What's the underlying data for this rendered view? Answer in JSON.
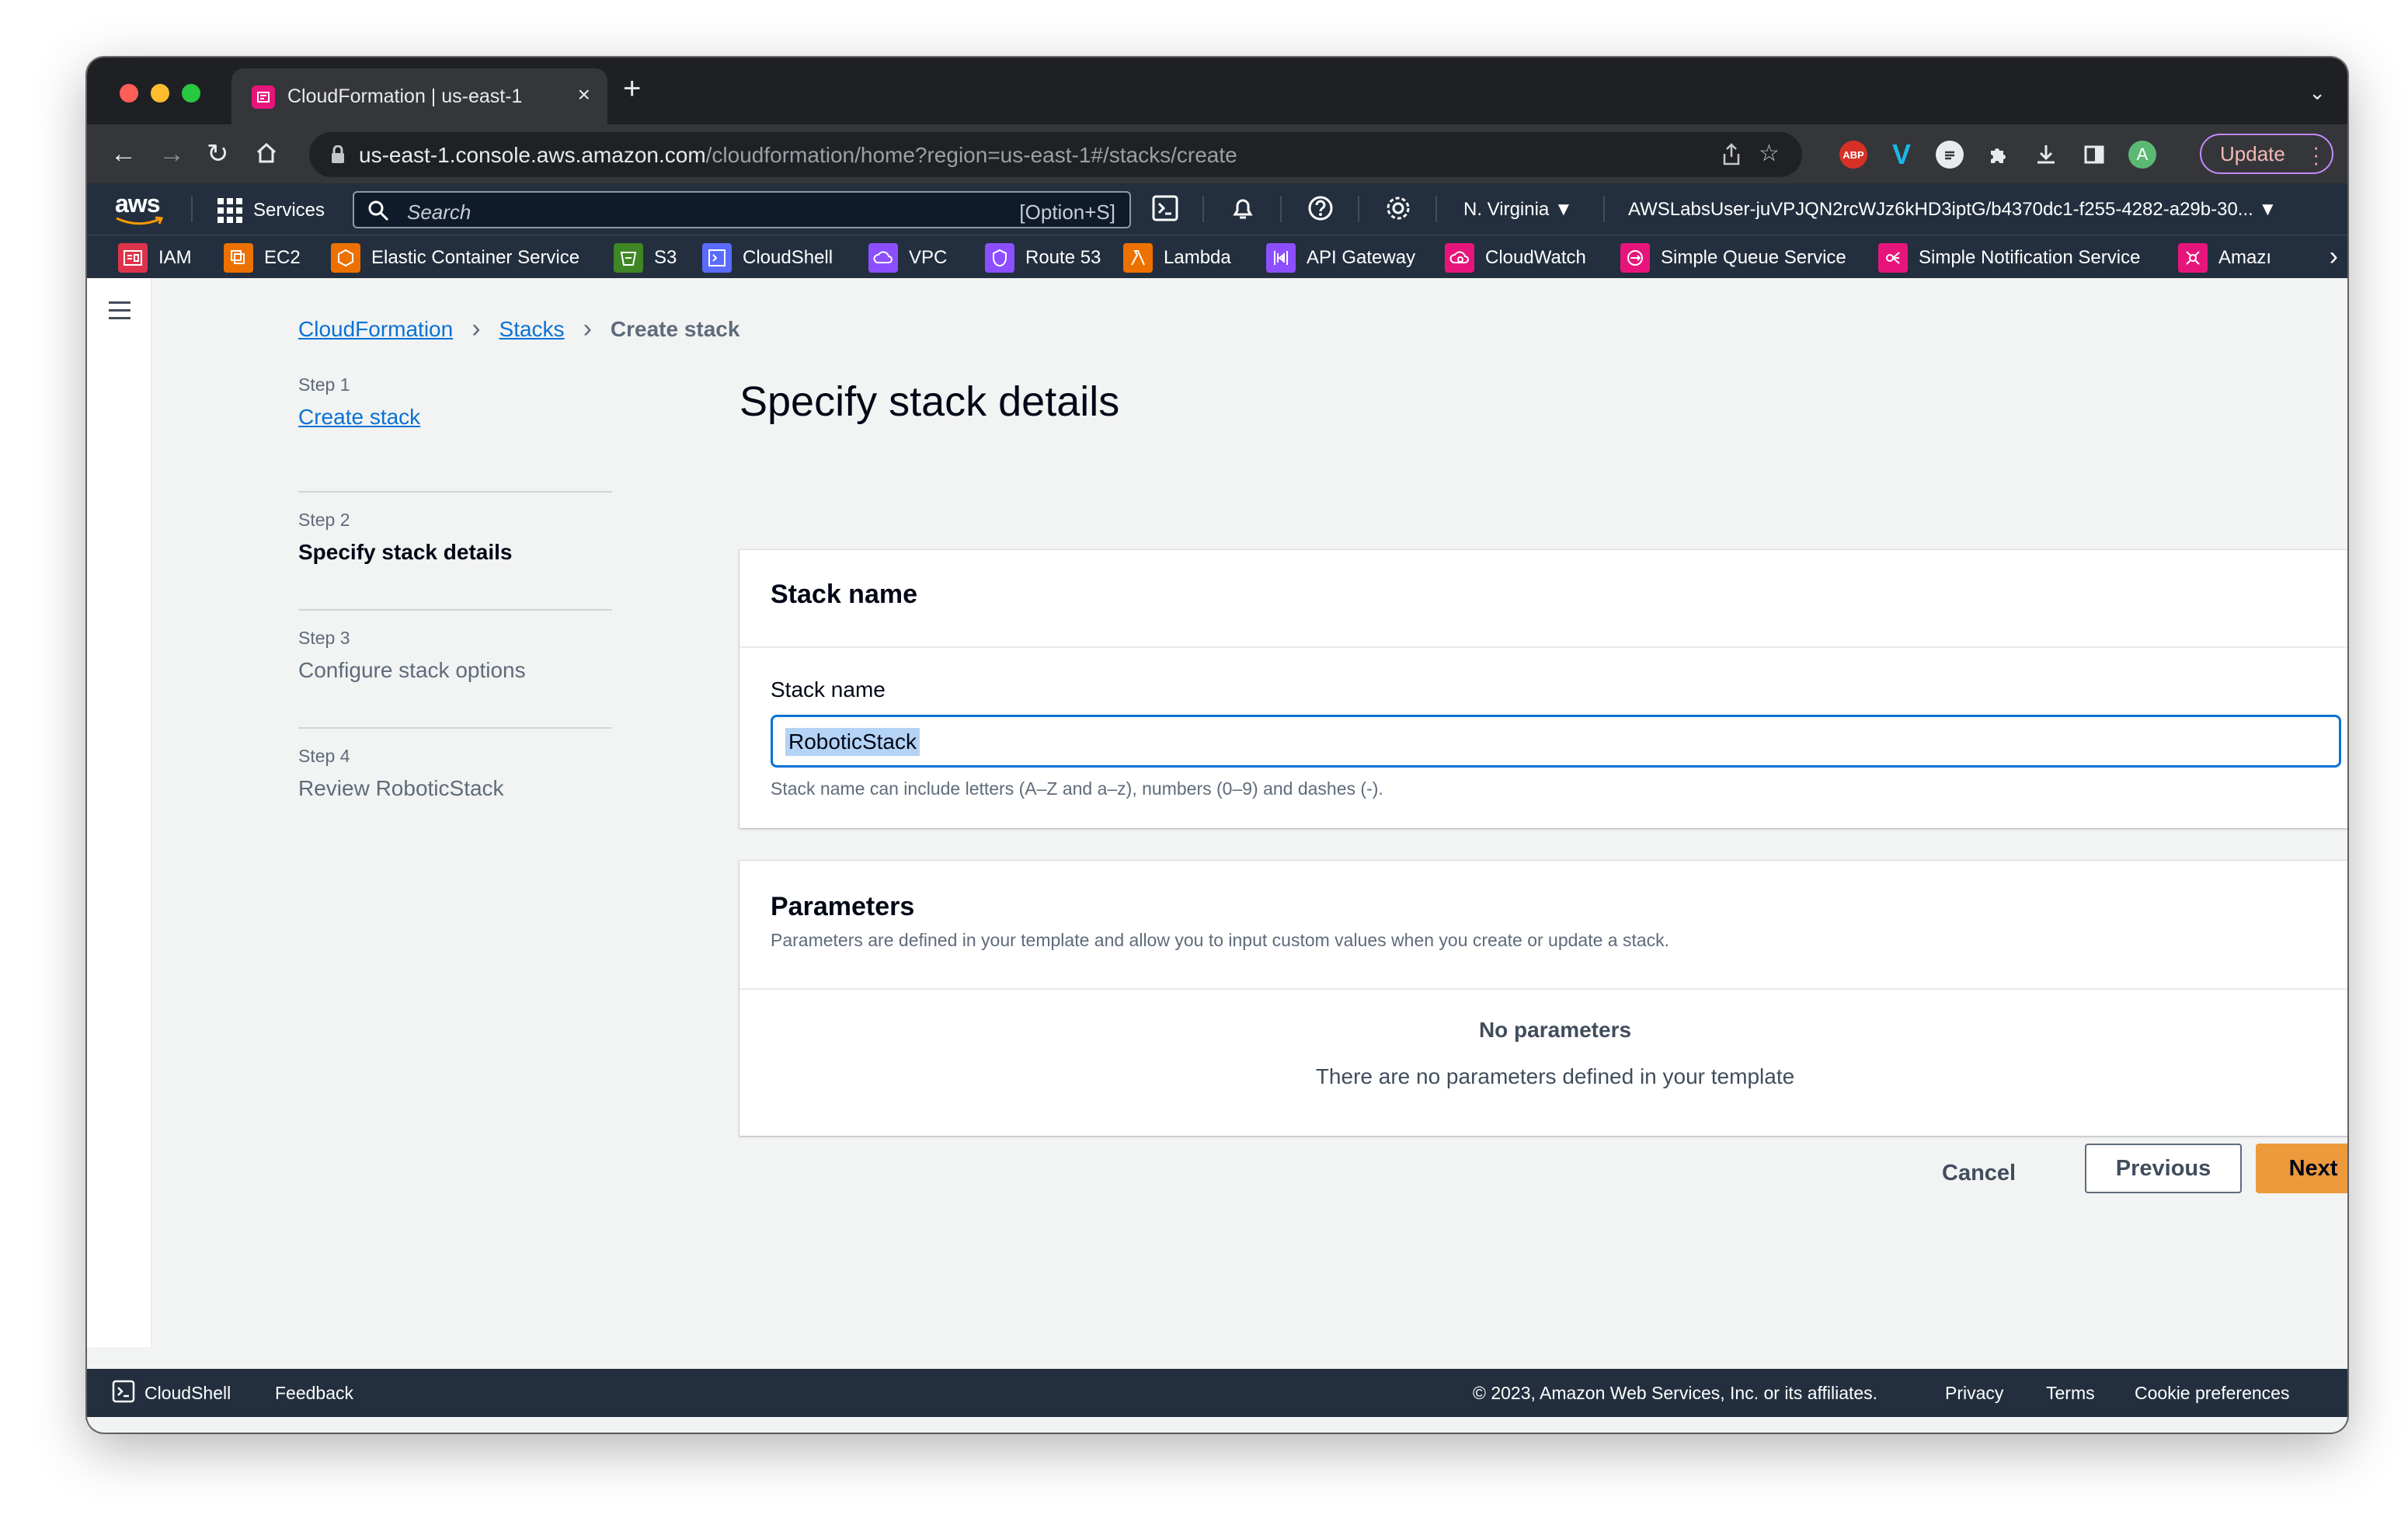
{
  "browser": {
    "tab_title": "CloudFormation | us-east-1",
    "tab_close": "×",
    "new_tab": "+",
    "url_host": "us-east-1.console.aws.amazon.com",
    "url_path": "/cloudformation/home?region=us-east-1#/stacks/create",
    "update_label": "Update",
    "extensions": [
      "abp-icon",
      "v-icon",
      "s-icon",
      "puzzle-icon",
      "download-icon",
      "sidepanel-icon",
      "profile-avatar"
    ],
    "profile_initial": "A",
    "abp_text": "ABP"
  },
  "aws_header": {
    "logo": "aws",
    "services_label": "Services",
    "search_placeholder": "Search",
    "search_shortcut": "[Option+S]",
    "region": "N. Virginia ▼",
    "account": "AWSLabsUser-juVPJQN2rcWJz6kHD3iptG/b4370dc1-f255-4282-a29b-30... ▼"
  },
  "favorites": [
    {
      "label": "IAM",
      "color": "#dd344c"
    },
    {
      "label": "EC2",
      "color": "#ed7100"
    },
    {
      "label": "Elastic Container Service",
      "color": "#ed7100"
    },
    {
      "label": "S3",
      "color": "#3f8624"
    },
    {
      "label": "CloudShell",
      "color": "#5a6bff"
    },
    {
      "label": "VPC",
      "color": "#8c4fff"
    },
    {
      "label": "Route 53",
      "color": "#8c4fff"
    },
    {
      "label": "Lambda",
      "color": "#ed7100"
    },
    {
      "label": "API Gateway",
      "color": "#8c4fff"
    },
    {
      "label": "CloudWatch",
      "color": "#e7157b"
    },
    {
      "label": "Simple Queue Service",
      "color": "#e7157b"
    },
    {
      "label": "Simple Notification Service",
      "color": "#e7157b"
    },
    {
      "label": "Amazı",
      "color": "#e7157b"
    }
  ],
  "breadcrumb": {
    "items": [
      "CloudFormation",
      "Stacks"
    ],
    "current": "Create stack"
  },
  "steps": [
    {
      "number": "Step 1",
      "label": "Create stack",
      "state": "link"
    },
    {
      "number": "Step 2",
      "label": "Specify stack details",
      "state": "current"
    },
    {
      "number": "Step 3",
      "label": "Configure stack options",
      "state": "disabled"
    },
    {
      "number": "Step 4",
      "label": "Review RoboticStack",
      "state": "disabled"
    }
  ],
  "page_title": "Specify stack details",
  "stack_name_panel": {
    "title": "Stack name",
    "field_label": "Stack name",
    "value": "RoboticStack",
    "constraint": "Stack name can include letters (A–Z and a–z), numbers (0–9) and dashes (-)."
  },
  "parameters_panel": {
    "title": "Parameters",
    "description": "Parameters are defined in your template and allow you to input custom values when you create or update a stack.",
    "empty_title": "No parameters",
    "empty_description": "There are no parameters defined in your template"
  },
  "actions": {
    "cancel": "Cancel",
    "previous": "Previous",
    "next": "Next"
  },
  "footer": {
    "cloudshell": "CloudShell",
    "feedback": "Feedback",
    "copyright": "© 2023, Amazon Web Services, Inc. or its affiliates.",
    "privacy": "Privacy",
    "terms": "Terms",
    "cookie": "Cookie preferences"
  },
  "colors": {
    "link": "#0972d3",
    "primary_button": "#ec9a3c",
    "aws_nav": "#232f3e"
  }
}
